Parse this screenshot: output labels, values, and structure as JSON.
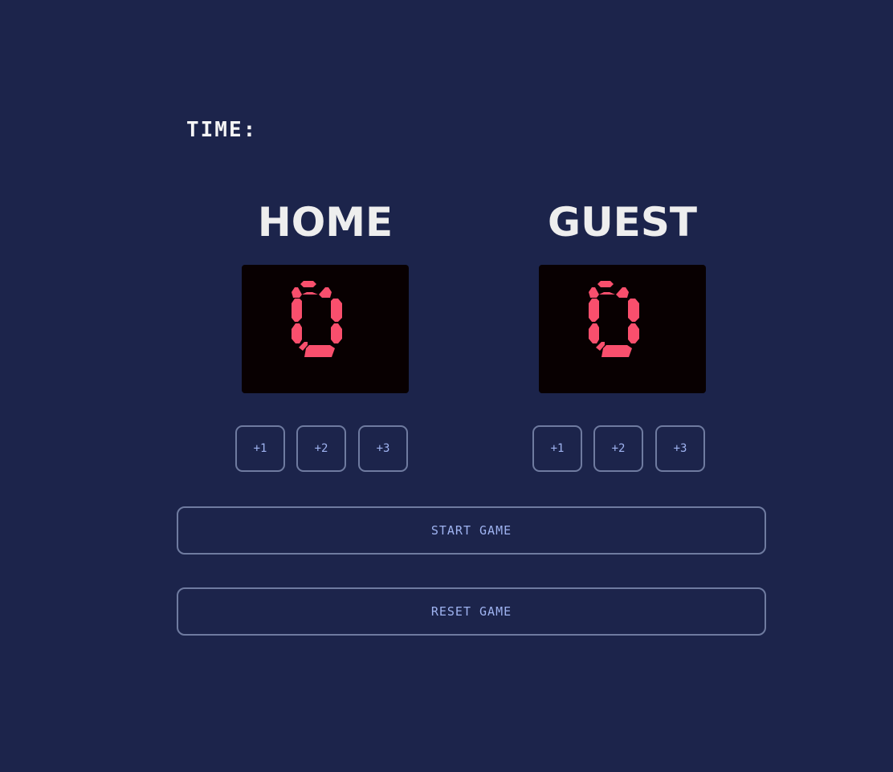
{
  "timer": {
    "label": "TIME:"
  },
  "home": {
    "name": "HOME",
    "score": "0",
    "buttons": [
      "+1",
      "+2",
      "+3"
    ]
  },
  "guest": {
    "name": "GUEST",
    "score": "0",
    "buttons": [
      "+1",
      "+2",
      "+3"
    ]
  },
  "controls": {
    "start_label": "START GAME",
    "reset_label": "RESET GAME"
  },
  "colors": {
    "background": "#1c244b",
    "score_background": "#080001",
    "score_digit": "#f94f6d",
    "button_text": "#9fb3f0",
    "button_border": "#6f7ba0",
    "team_name": "#eeeeee"
  },
  "icons": {
    "score_digit": "seven-segment-digit"
  }
}
